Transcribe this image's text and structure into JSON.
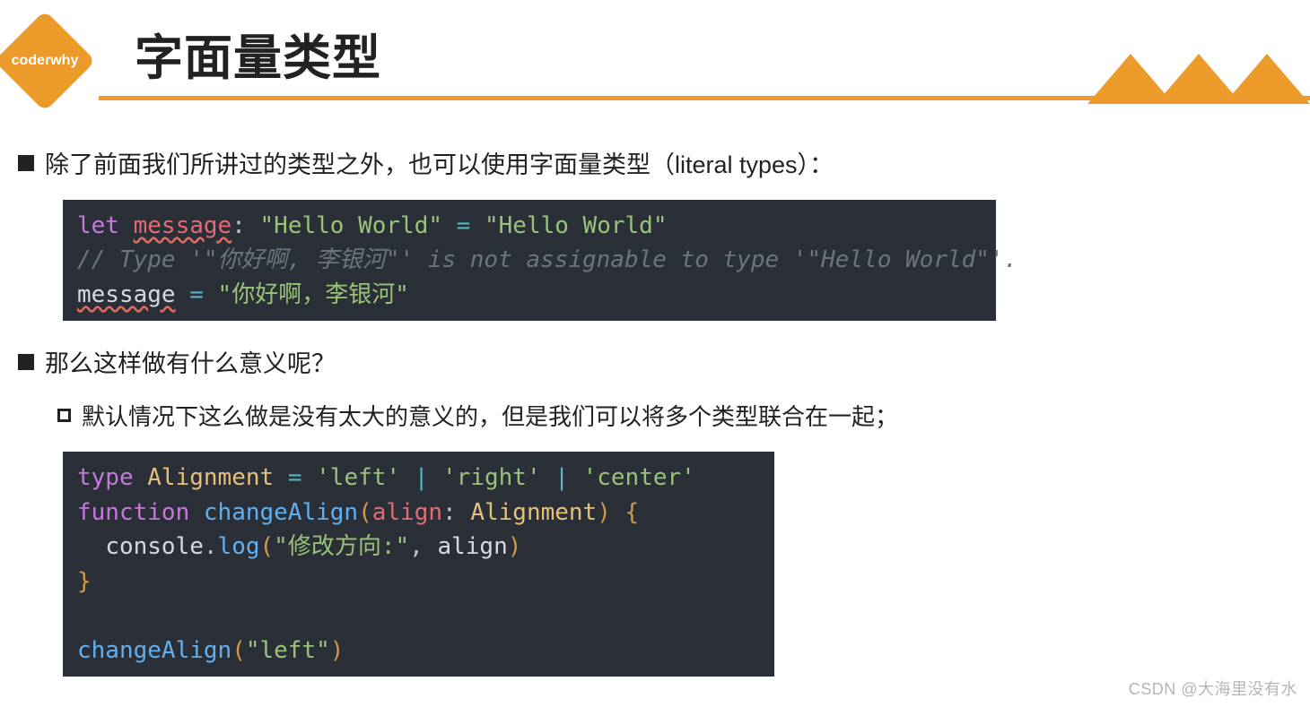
{
  "logo": {
    "text": "coderwhy"
  },
  "title": "字面量类型",
  "bullets": {
    "b1": "除了前面我们所讲过的类型之外，也可以使用字面量类型（literal types）：",
    "b2": "那么这样做有什么意义呢？",
    "sub1": "默认情况下这么做是没有太大的意义的，但是我们可以将多个类型联合在一起；"
  },
  "code1": {
    "let": "let",
    "msg": "message",
    "hello": "\"Hello World\"",
    "eq": "=",
    "colon": ":",
    "comment": "// Type '\"你好啊, 李银河\"' is not assignable to type '\"Hello World\"'.",
    "msg2": "message",
    "nihao": "\"你好啊，李银河\""
  },
  "code2": {
    "type": "type",
    "Alignment": "Alignment",
    "eq": "=",
    "left": "'left'",
    "right": "'right'",
    "center": "'center'",
    "pipe": "|",
    "function": "function",
    "changeAlign": "changeAlign",
    "lp": "(",
    "align": "align",
    "colon": ":",
    "AlignmentT": "Alignment",
    "rp": ")",
    "lb": "{",
    "rb": "}",
    "console": "console",
    "dot": ".",
    "log": "log",
    "logstr": "\"修改方向:\"",
    "comma": ",",
    "alignArg": "align",
    "callArg": "\"left\""
  },
  "watermark": "CSDN @大海里没有水"
}
